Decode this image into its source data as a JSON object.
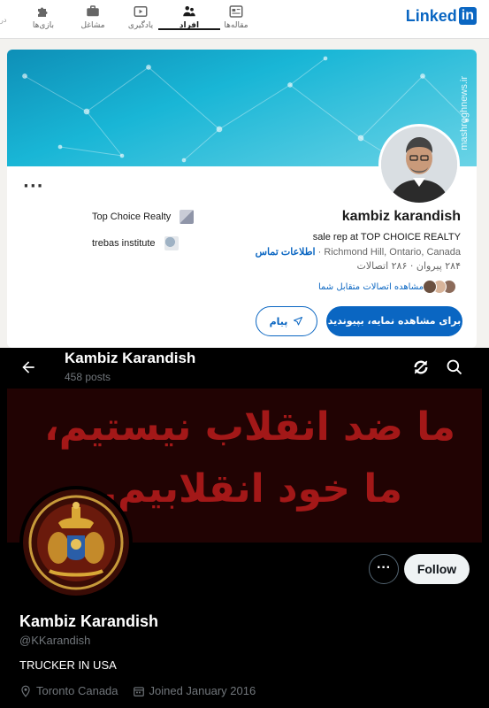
{
  "linkedin": {
    "logo_text": "Linked",
    "logo_in": "in",
    "nav_cut_label": "در",
    "nav": [
      {
        "label": "بازی‌ها",
        "icon": "puzzle-icon"
      },
      {
        "label": "مشاغل",
        "icon": "briefcase-icon"
      },
      {
        "label": "یادگیری",
        "icon": "play-icon"
      },
      {
        "label": "افراد",
        "icon": "people-icon"
      },
      {
        "label": "مقاله‌ها",
        "icon": "article-icon"
      }
    ],
    "active_nav": "افراد",
    "profile": {
      "name": "kambiz karandish",
      "headline": "sale rep at TOP CHOICE REALTY",
      "location": "Richmond Hill, Ontario, Canada",
      "contact_info": "اطلاعات تماس",
      "followers": "۲۸۴ پیروان",
      "connections": "۲۸۶ اتصالات",
      "mutual_connections": "مشاهده اتصالات متقابل شما",
      "experience": [
        {
          "label": "Top Choice Realty"
        },
        {
          "label": "trebas institute"
        }
      ]
    },
    "buttons": {
      "primary": "برای مشاهده نمایه، بپیوندید",
      "message": "پیام"
    },
    "watermark": "mashreghnews.ir"
  },
  "twitter": {
    "header": {
      "display_name": "Kambiz Karandish",
      "posts": "458 posts"
    },
    "banner": {
      "line1": "ما ضد انقلاب نیستیم،",
      "line2": "ما خود انقلابیم."
    },
    "profile": {
      "display_name": "Kambiz Karandish",
      "handle": "@KKarandish",
      "bio": "TRUCKER IN USA",
      "location": "Toronto Canada",
      "joined": "Joined January 2016"
    },
    "buttons": {
      "more": "···",
      "follow": "Follow"
    }
  },
  "colors": {
    "linkedin_blue": "#0a66c2",
    "banner_red": "#a31818",
    "x_background": "#000000"
  }
}
